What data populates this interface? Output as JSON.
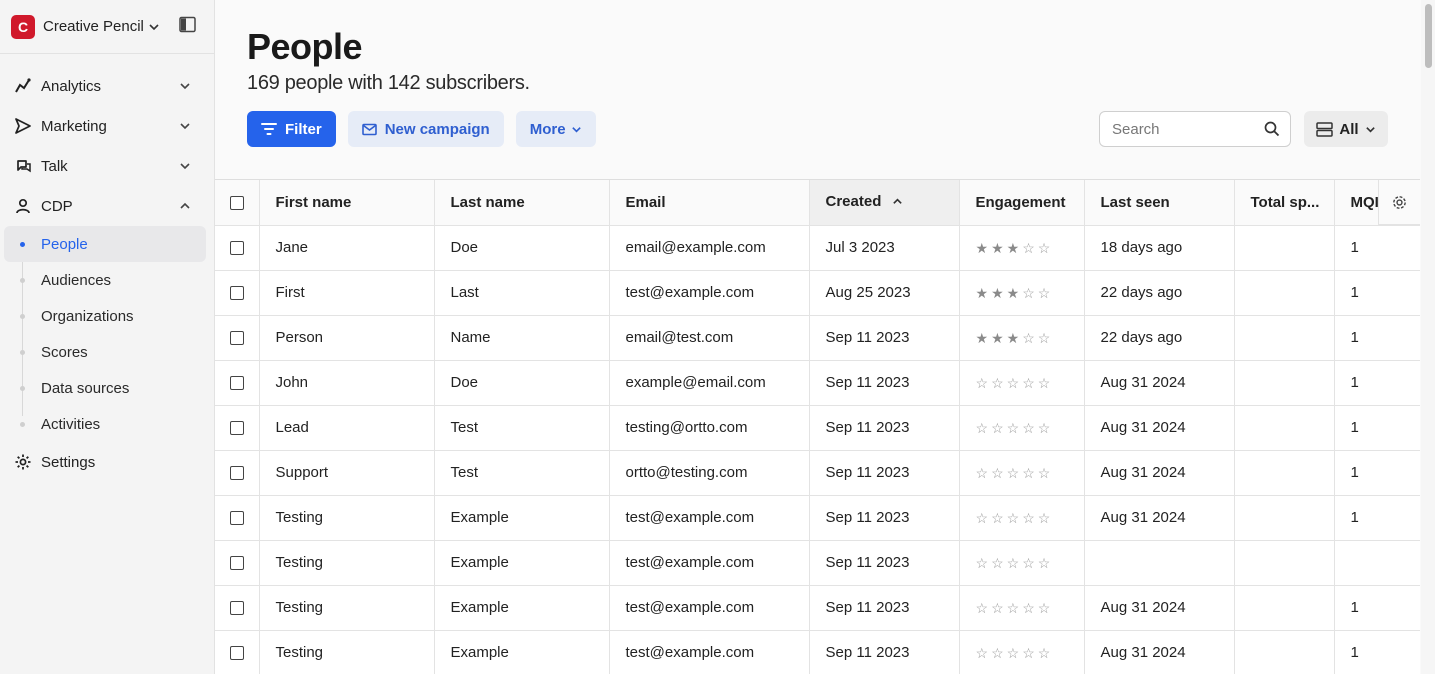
{
  "workspace": {
    "initial": "C",
    "name": "Creative Pencil"
  },
  "nav": {
    "analytics": "Analytics",
    "marketing": "Marketing",
    "talk": "Talk",
    "cdp": "CDP",
    "settings": "Settings",
    "cdp_items": [
      "People",
      "Audiences",
      "Organizations",
      "Scores",
      "Data sources",
      "Activities"
    ]
  },
  "page": {
    "title": "People",
    "subtitle": "169 people with 142 subscribers."
  },
  "toolbar": {
    "filter": "Filter",
    "new_campaign": "New campaign",
    "more": "More",
    "search_placeholder": "Search",
    "view": "All"
  },
  "table": {
    "columns": [
      "First name",
      "Last name",
      "Email",
      "Created",
      "Engagement",
      "Last seen",
      "Total sp...",
      "MQI"
    ],
    "rows": [
      {
        "first": "Jane",
        "last": "Doe",
        "email": "email@example.com",
        "created": "Jul 3 2023",
        "stars": 3,
        "seen": "18 days ago",
        "total": "",
        "mqi": "1"
      },
      {
        "first": "First",
        "last": "Last",
        "email": "test@example.com",
        "created": "Aug 25 2023",
        "stars": 3,
        "seen": "22 days ago",
        "total": "",
        "mqi": "1"
      },
      {
        "first": "Person",
        "last": "Name",
        "email": "email@test.com",
        "created": "Sep 11 2023",
        "stars": 3,
        "seen": "22 days ago",
        "total": "",
        "mqi": "1"
      },
      {
        "first": "John",
        "last": "Doe",
        "email": "example@email.com",
        "created": "Sep 11 2023",
        "stars": 0,
        "seen": "Aug 31 2024",
        "total": "",
        "mqi": "1"
      },
      {
        "first": "Lead",
        "last": "Test",
        "email": "testing@ortto.com",
        "created": "Sep 11 2023",
        "stars": 0,
        "seen": "Aug 31 2024",
        "total": "",
        "mqi": "1"
      },
      {
        "first": "Support",
        "last": "Test",
        "email": "ortto@testing.com",
        "created": "Sep 11 2023",
        "stars": 0,
        "seen": "Aug 31 2024",
        "total": "",
        "mqi": "1"
      },
      {
        "first": "Testing",
        "last": "Example",
        "email": "test@example.com",
        "created": "Sep 11 2023",
        "stars": 0,
        "seen": "Aug 31 2024",
        "total": "",
        "mqi": "1"
      },
      {
        "first": "Testing",
        "last": "Example",
        "email": "test@example.com",
        "created": "Sep 11 2023",
        "stars": 0,
        "seen": "",
        "total": "",
        "mqi": ""
      },
      {
        "first": "Testing",
        "last": "Example",
        "email": "test@example.com",
        "created": "Sep 11 2023",
        "stars": 0,
        "seen": "Aug 31 2024",
        "total": "",
        "mqi": "1"
      },
      {
        "first": "Testing",
        "last": "Example",
        "email": "test@example.com",
        "created": "Sep 11 2023",
        "stars": 0,
        "seen": "Aug 31 2024",
        "total": "",
        "mqi": "1"
      }
    ]
  },
  "colors": {
    "accent": "#2563eb",
    "brand": "#d0192b"
  }
}
